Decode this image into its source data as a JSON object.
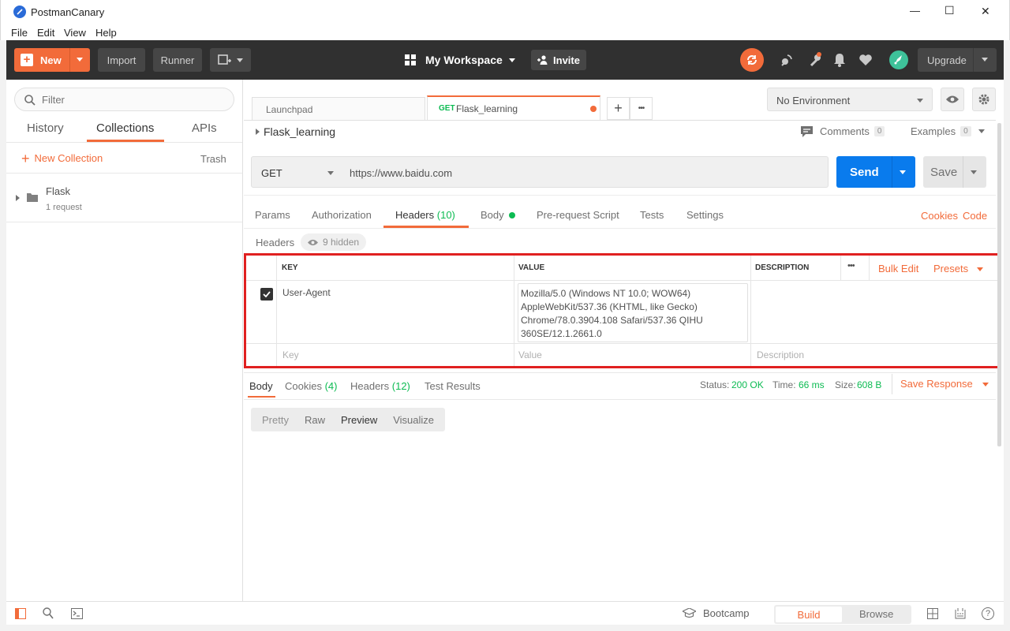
{
  "window": {
    "title": "PostmanCanary",
    "controls": {
      "minimize": "—",
      "maximize": "☐",
      "close": "✕"
    }
  },
  "menu": [
    "File",
    "Edit",
    "View",
    "Help"
  ],
  "toolbar": {
    "new_label": "New",
    "import_label": "Import",
    "runner_label": "Runner",
    "workspace_label": "My Workspace",
    "invite_label": "Invite",
    "upgrade_label": "Upgrade"
  },
  "sidebar": {
    "filter_placeholder": "Filter",
    "tabs": [
      "History",
      "Collections",
      "APIs"
    ],
    "active_tab": "Collections",
    "new_collection_label": "New Collection",
    "trash_label": "Trash",
    "collection": {
      "name": "Flask",
      "count": "1 request"
    }
  },
  "tabs": {
    "launchpad": "Launchpad",
    "active_method": "GET",
    "active_name": "Flask_learning",
    "add": "+",
    "more": "•••"
  },
  "environment": {
    "selected": "No Environment"
  },
  "request": {
    "breadcrumb": "Flask_learning",
    "comments_label": "Comments",
    "comments_count": "0",
    "examples_label": "Examples",
    "examples_count": "0",
    "method": "GET",
    "url": "https://www.baidu.com",
    "send_label": "Send",
    "save_label": "Save"
  },
  "req_tabs": {
    "params": "Params",
    "authorization": "Authorization",
    "headers": "Headers",
    "headers_count": "(10)",
    "body": "Body",
    "prerequest": "Pre-request Script",
    "tests": "Tests",
    "settings": "Settings",
    "cookies": "Cookies",
    "code": "Code"
  },
  "headers_section": {
    "label": "Headers",
    "hidden": "9 hidden"
  },
  "headers_table": {
    "col_key": "KEY",
    "col_value": "VALUE",
    "col_description": "DESCRIPTION",
    "more": "•••",
    "bulk_edit": "Bulk Edit",
    "presets": "Presets",
    "row": {
      "key": "User-Agent",
      "value_lines": [
        "Mozilla/5.0 (Windows NT 10.0; WOW64)",
        "AppleWebKit/537.36 (KHTML, like Gecko)",
        "Chrome/78.0.3904.108 Safari/537.36 QIHU",
        "360SE/12.1.2661.0"
      ]
    },
    "placeholder_key": "Key",
    "placeholder_value": "Value",
    "placeholder_description": "Description"
  },
  "response": {
    "tabs": {
      "body": "Body",
      "cookies": "Cookies",
      "cookies_count": "(4)",
      "headers": "Headers",
      "headers_count": "(12)",
      "tests": "Test Results"
    },
    "status_label": "Status:",
    "status_value": "200 OK",
    "time_label": "Time:",
    "time_value": "66 ms",
    "size_label": "Size:",
    "size_value": "608 B",
    "save_response": "Save Response",
    "view_modes": [
      "Pretty",
      "Raw",
      "Preview",
      "Visualize"
    ],
    "active_view": "Preview"
  },
  "statusbar": {
    "bootcamp": "Bootcamp",
    "build": "Build",
    "browse": "Browse"
  },
  "colors": {
    "accent": "#f26b3a",
    "send": "#097bed",
    "status_ok": "#0cbb52",
    "highlight": "#e02020"
  }
}
